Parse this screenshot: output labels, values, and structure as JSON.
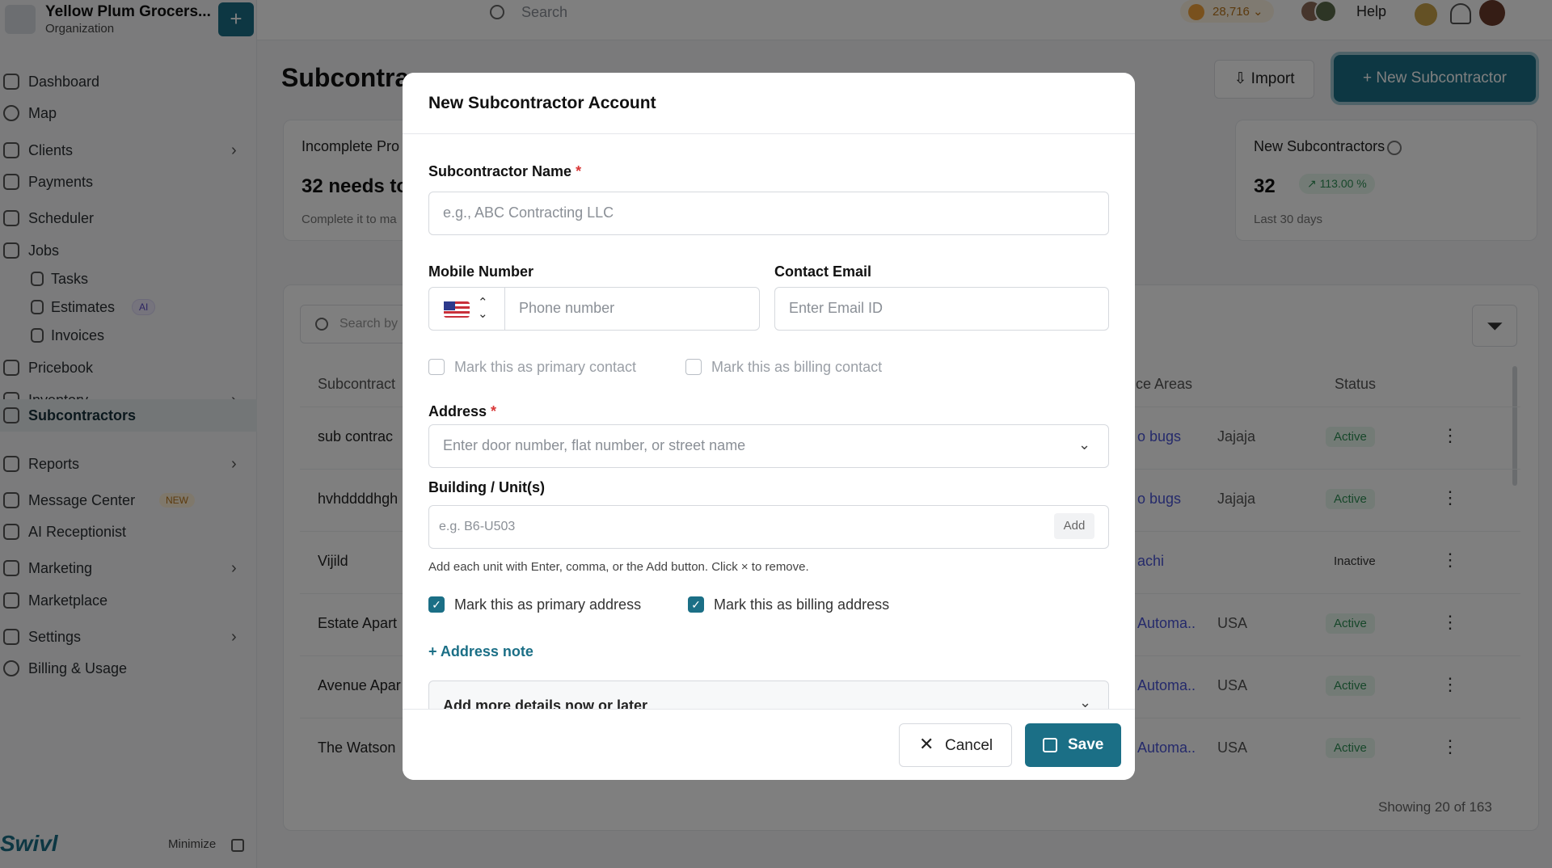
{
  "org": {
    "name": "Yellow Plum Grocers...",
    "subtitle": "Organization",
    "plus": "+"
  },
  "topbar": {
    "search_placeholder": "Search",
    "credits": "28,716",
    "help": "Help"
  },
  "sidebar": {
    "items": [
      {
        "label": "Dashboard"
      },
      {
        "label": "Map"
      },
      {
        "label": "Clients"
      },
      {
        "label": "Payments"
      },
      {
        "label": "Scheduler"
      },
      {
        "label": "Jobs"
      },
      {
        "label": "Tasks"
      },
      {
        "label": "Estimates",
        "badge": "AI"
      },
      {
        "label": "Invoices"
      },
      {
        "label": "Pricebook"
      },
      {
        "label": "Inventory"
      },
      {
        "label": "Subcontractors"
      },
      {
        "label": "Reports"
      },
      {
        "label": "Message Center",
        "badge": "NEW"
      },
      {
        "label": "AI Receptionist"
      },
      {
        "label": "Marketing"
      },
      {
        "label": "Marketplace"
      },
      {
        "label": "Settings"
      },
      {
        "label": "Billing & Usage"
      }
    ],
    "brand": "Swivl",
    "minimize": "Minimize"
  },
  "page": {
    "title": "Subcontra",
    "import": "Import",
    "new_button": "New Subcontractor",
    "card1": {
      "title": "Incomplete Pro",
      "big": "32 needs to",
      "sub": "Complete it to ma"
    },
    "card2": {
      "title": "New Subcontractors",
      "big": "32",
      "pct": "113.00 %",
      "sub": "Last 30 days"
    },
    "search_placeholder": "Search by",
    "columns": [
      "Subcontract",
      "ce Areas",
      "Status"
    ],
    "rows": [
      {
        "name": "sub contrac",
        "area": "o bugs",
        "area2": "Jajaja",
        "status": "Active"
      },
      {
        "name": "hvhddddhgh",
        "area": "o bugs",
        "area2": "Jajaja",
        "status": "Active"
      },
      {
        "name": "Vijild",
        "area": "achi",
        "area2": "",
        "status": "Inactive"
      },
      {
        "name": "Estate Apart",
        "area": "Automa..",
        "area2": "USA",
        "status": "Active"
      },
      {
        "name": "Avenue Apar",
        "area": "Automa..",
        "area2": "USA",
        "status": "Active"
      },
      {
        "name": "The Watson",
        "area": "Automa..",
        "area2": "USA",
        "status": "Active"
      }
    ],
    "showing": "Showing 20 of 163"
  },
  "modal": {
    "title": "New Subcontractor Account",
    "name_label": "Subcontractor Name",
    "name_placeholder": "e.g., ABC Contracting LLC",
    "mobile_label": "Mobile Number",
    "phone_placeholder": "Phone number",
    "email_label": "Contact Email",
    "email_placeholder": "Enter Email ID",
    "primary_contact": "Mark this as primary contact",
    "billing_contact": "Mark this as billing contact",
    "address_label": "Address",
    "address_placeholder": "Enter door number, flat number, or street name",
    "building_label": "Building / Unit(s)",
    "building_placeholder": "e.g. B6-U503",
    "add": "Add",
    "helper": "Add each unit with Enter, comma, or the Add button. Click × to remove.",
    "primary_address": "Mark this as primary address",
    "billing_address": "Mark this as billing address",
    "address_note": "+ Address note",
    "more_details": "Add more details now or later",
    "cancel": "Cancel",
    "save": "Save",
    "required_mark": "*"
  },
  "colors": {
    "accent": "#1b6f86",
    "required": "#d93838",
    "active_green": "#2e8f55"
  },
  "icons": [
    "search-icon",
    "bell-icon",
    "import-icon",
    "plus-icon",
    "filter-icon",
    "info-icon",
    "chevron-down-icon",
    "close-icon",
    "save-icon",
    "check-icon",
    "us-flag-icon"
  ]
}
